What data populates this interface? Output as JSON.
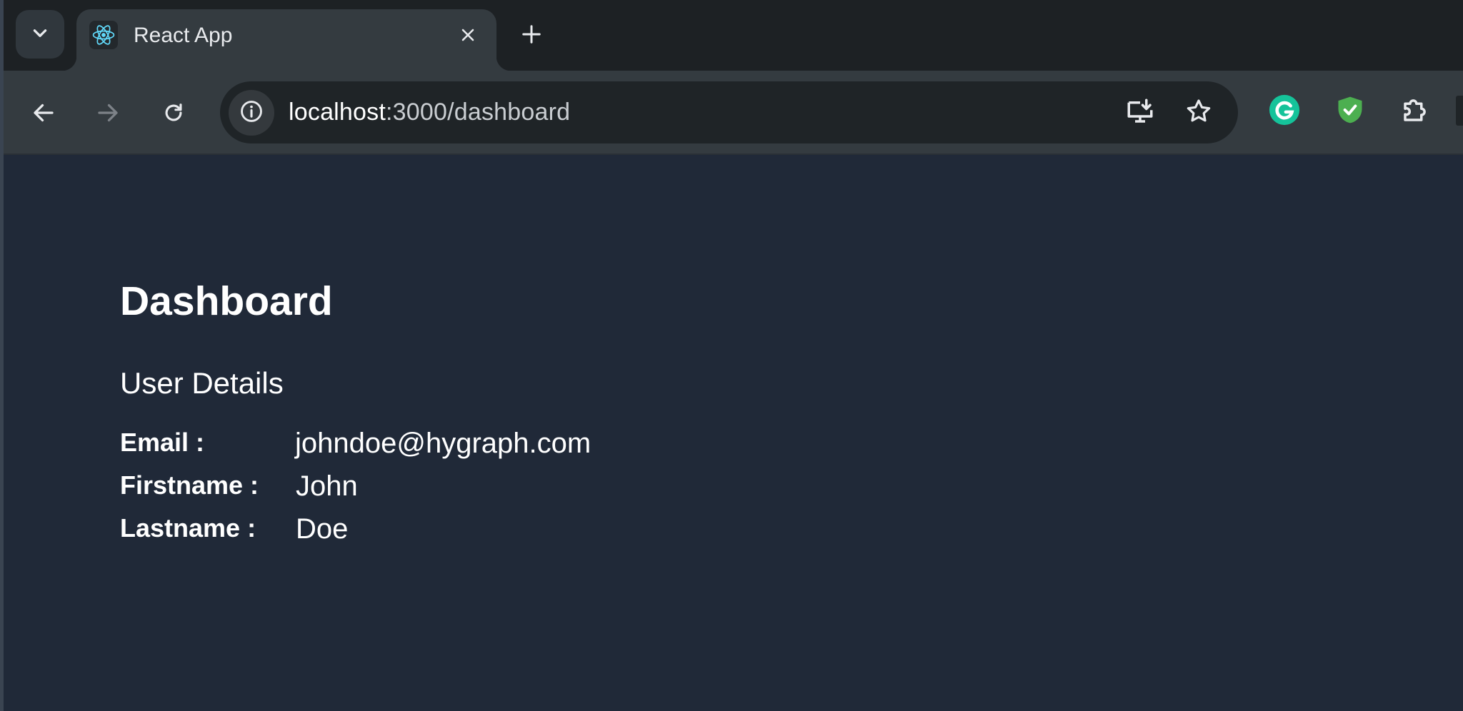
{
  "browser": {
    "tab": {
      "title": "React App"
    },
    "address_bar": {
      "host": "localhost",
      "path": ":3000/dashboard"
    },
    "icons": {
      "tab_search": "chevron-down-icon",
      "favicon": "react-logo-icon",
      "tab_close": "close-icon",
      "new_tab": "plus-icon",
      "back": "arrow-left-icon",
      "forward": "arrow-right-icon",
      "reload": "reload-icon",
      "site_info": "info-icon",
      "install": "install-app-icon",
      "bookmark": "star-icon",
      "grammarly": "grammarly-icon",
      "shield": "shield-check-icon",
      "extensions": "puzzle-icon"
    },
    "colors": {
      "grammarly": "#15c39a",
      "shield": "#4caf50"
    }
  },
  "page": {
    "title": "Dashboard",
    "subtitle": "User Details",
    "details": [
      {
        "label": "Email :",
        "value": "johndoe@hygraph.com"
      },
      {
        "label": "Firstname :",
        "value": "John"
      },
      {
        "label": "Lastname :",
        "value": "Doe"
      }
    ]
  }
}
